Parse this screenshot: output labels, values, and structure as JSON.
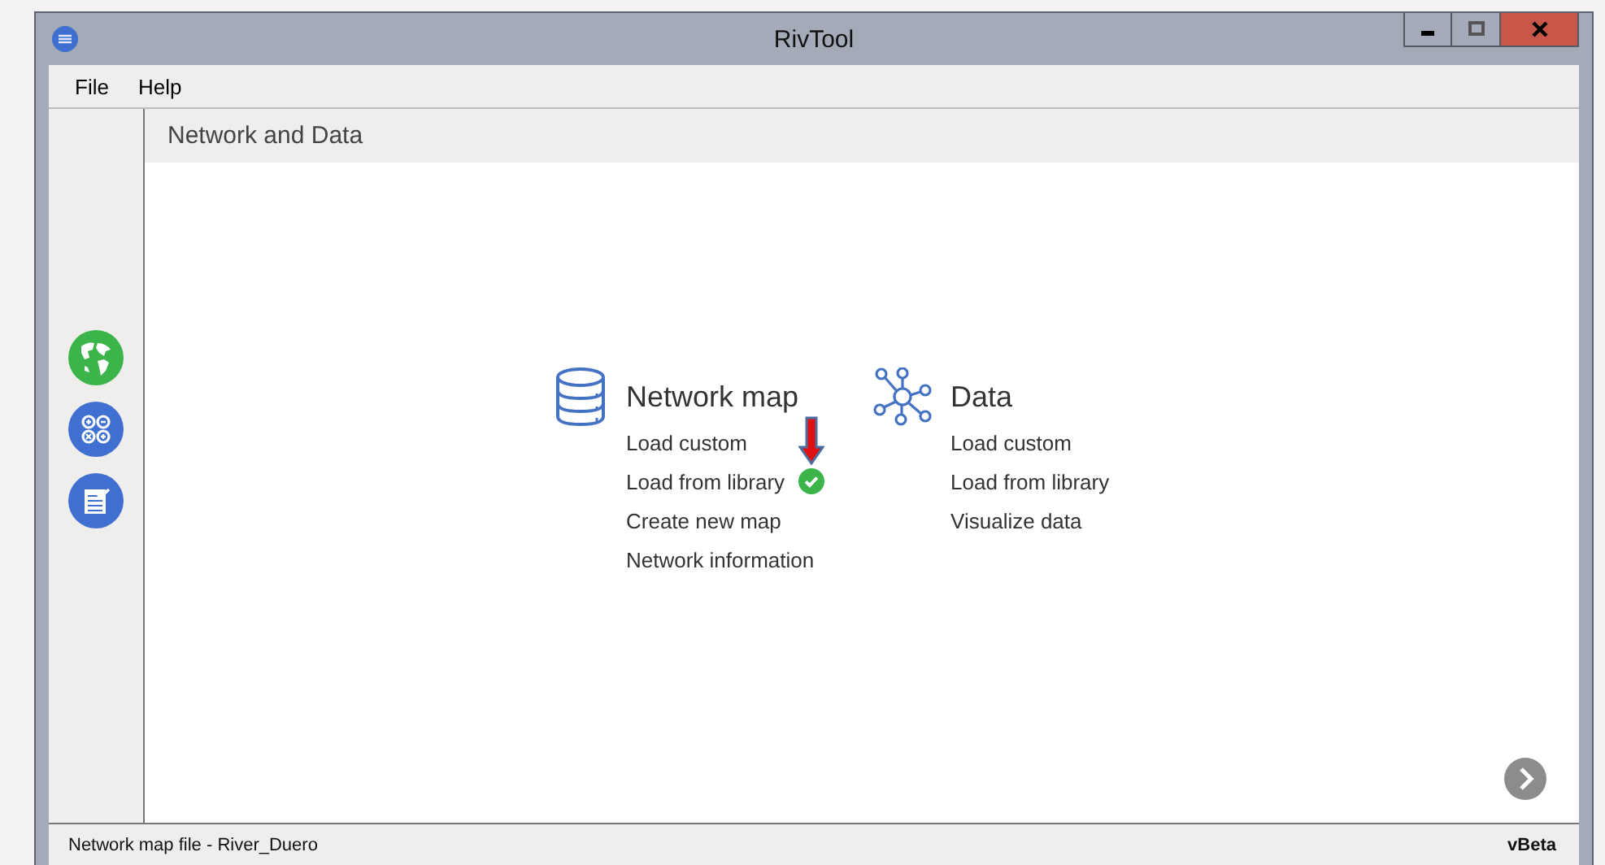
{
  "window": {
    "title": "RivTool"
  },
  "menu": [
    "File",
    "Help"
  ],
  "sidebar": {
    "items": [
      {
        "kind": "globe"
      },
      {
        "kind": "calculator"
      },
      {
        "kind": "report"
      }
    ]
  },
  "header": "Network and Data",
  "sections": [
    {
      "kind": "database",
      "title": "Network map",
      "items": [
        {
          "label": "Load custom",
          "checked": false
        },
        {
          "label": "Load from library",
          "checked": true
        },
        {
          "label": "Create new map",
          "checked": false
        },
        {
          "label": "Network information",
          "checked": false
        }
      ]
    },
    {
      "kind": "network",
      "title": "Data",
      "items": [
        {
          "label": "Load custom",
          "checked": false
        },
        {
          "label": "Load from library",
          "checked": false
        },
        {
          "label": "Visualize data",
          "checked": false
        }
      ]
    }
  ],
  "status_bar": {
    "text": "Network map file - River_Duero",
    "version": "vBeta"
  }
}
